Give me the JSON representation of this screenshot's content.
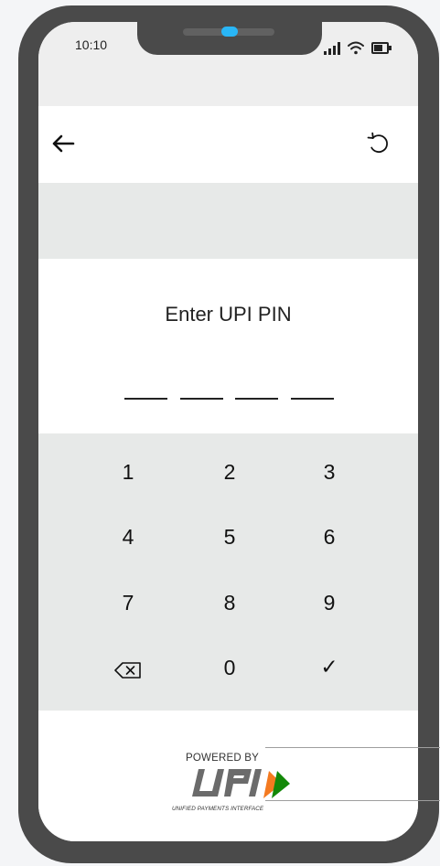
{
  "status_bar": {
    "time": "10:10"
  },
  "header": {
    "back_icon": "arrow-left-icon",
    "refresh_icon": "refresh-icon"
  },
  "pin": {
    "title": "Enter UPI PIN",
    "slots": 4
  },
  "keypad": {
    "keys": [
      "1",
      "2",
      "3",
      "4",
      "5",
      "6",
      "7",
      "8",
      "9",
      "",
      "0",
      ""
    ],
    "backspace_icon": "backspace-icon",
    "submit_label": "✓"
  },
  "footer": {
    "powered_by": "POWERED BY",
    "logo_text": "UPI",
    "logo_subtitle": "UNIFIED PAYMENTS INTERFACE"
  },
  "colors": {
    "device_frame": "#4a4a4a",
    "keypad_bg": "#e7e9e8",
    "upi_orange": "#f47a20",
    "upi_green": "#138808",
    "camera": "#29b6f6"
  }
}
